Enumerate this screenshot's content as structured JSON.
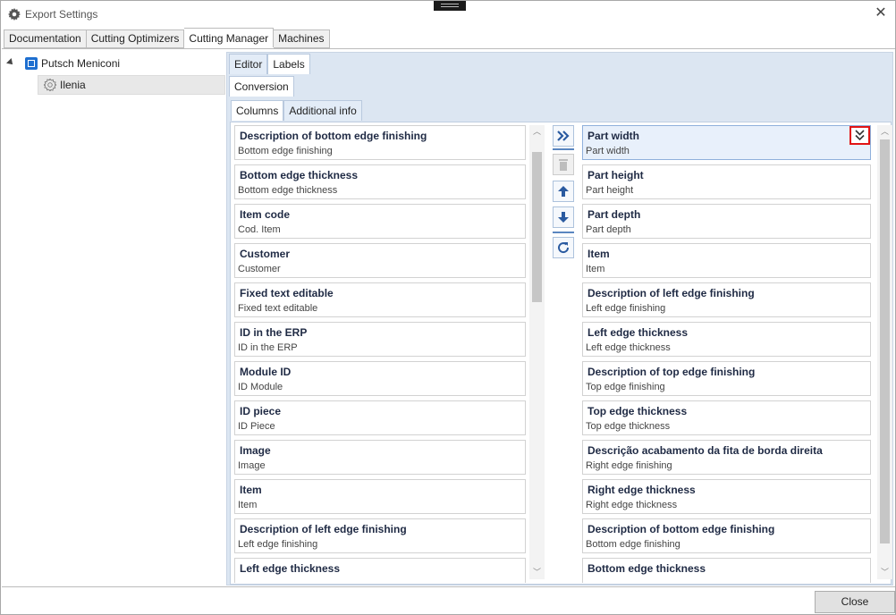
{
  "window": {
    "title": "Export Settings"
  },
  "main_tabs": [
    {
      "label": "Documentation"
    },
    {
      "label": "Cutting Optimizers"
    },
    {
      "label": "Cutting Manager"
    },
    {
      "label": "Machines"
    }
  ],
  "active_main_tab": "Cutting Manager",
  "tree": {
    "root": {
      "label": "Putsch Meniconi"
    },
    "child": {
      "label": "Ilenia"
    }
  },
  "editor_tabs": [
    {
      "label": "Editor"
    },
    {
      "label": "Labels"
    }
  ],
  "conversion_tab": {
    "label": "Conversion"
  },
  "column_tabs": [
    {
      "label": "Columns"
    },
    {
      "label": "Additional info"
    }
  ],
  "available_columns": [
    {
      "name": "Description of bottom edge finishing",
      "label": "Bottom edge finishing"
    },
    {
      "name": "Bottom edge thickness",
      "label": "Bottom edge thickness"
    },
    {
      "name": "Item code",
      "label": "Cod. Item"
    },
    {
      "name": "Customer",
      "label": "Customer"
    },
    {
      "name": "Fixed text editable",
      "label": "Fixed text editable"
    },
    {
      "name": "ID in the ERP",
      "label": "ID in the ERP"
    },
    {
      "name": "Module ID",
      "label": "ID Module"
    },
    {
      "name": "ID piece",
      "label": "ID Piece"
    },
    {
      "name": "Image",
      "label": "Image"
    },
    {
      "name": "Item",
      "label": "Item"
    },
    {
      "name": "Description of left edge finishing",
      "label": "Left edge finishing"
    },
    {
      "name": "Left edge thickness",
      "label": ""
    }
  ],
  "selected_columns": [
    {
      "name": "Part width",
      "label": "Part width"
    },
    {
      "name": "Part height",
      "label": "Part height"
    },
    {
      "name": "Part depth",
      "label": "Part depth"
    },
    {
      "name": "Item",
      "label": "Item"
    },
    {
      "name": "Description of left edge finishing",
      "label": "Left edge finishing"
    },
    {
      "name": "Left edge thickness",
      "label": "Left edge thickness"
    },
    {
      "name": "Description of top edge finishing",
      "label": "Top edge finishing"
    },
    {
      "name": "Top edge thickness",
      "label": "Top edge thickness"
    },
    {
      "name": "Descrição acabamento da fita de borda direita",
      "label": "Right edge finishing"
    },
    {
      "name": "Right edge thickness",
      "label": "Right edge thickness"
    },
    {
      "name": "Description of bottom edge finishing",
      "label": "Bottom edge finishing"
    },
    {
      "name": "Bottom edge thickness",
      "label": ""
    }
  ],
  "buttons": {
    "close": "Close"
  },
  "icons": {
    "add": "double-chevron-right-icon",
    "delete": "trash-icon",
    "move_up": "arrow-up-icon",
    "move_down": "arrow-down-icon",
    "reset": "refresh-icon",
    "expand": "double-chevron-down-icon"
  },
  "colors": {
    "accent": "#2a5aa0",
    "highlight": "#e11414",
    "panel": "#dce6f2"
  }
}
